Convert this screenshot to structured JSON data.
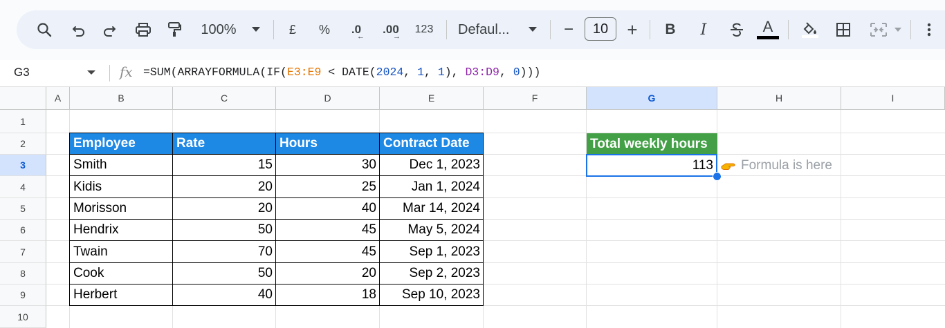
{
  "toolbar": {
    "zoom": "100%",
    "currency": "£",
    "percent": "%",
    "decrease_decimal": ".0",
    "increase_decimal": ".00",
    "number_format": "123",
    "font": "Defaul...",
    "font_size": "10",
    "minus": "−",
    "plus": "+",
    "bold": "B",
    "italic": "I",
    "text_color_letter": "A"
  },
  "formula_bar": {
    "cell_ref": "G3",
    "fx": "fx",
    "f1": "=SUM(ARRAYFORMULA(IF(",
    "f2": "E3:E9",
    "f3": " < DATE(",
    "f4": "2024",
    "f5": ", ",
    "f6": "1",
    "f7": ", ",
    "f8": "1",
    "f9": "), ",
    "f10": "D3:D9",
    "f11": ", ",
    "f12": "0",
    "f13": ")))"
  },
  "colors": {
    "header_blue": "#1e88e5",
    "header_green": "#43a047",
    "range_orange": "#e37400",
    "range_purple": "#8e24aa",
    "number_blue": "#1a56c4"
  },
  "columns": [
    "A",
    "B",
    "C",
    "D",
    "E",
    "F",
    "G",
    "H",
    "I"
  ],
  "rows": [
    "1",
    "2",
    "3",
    "4",
    "5",
    "6",
    "7",
    "8",
    "9",
    "10"
  ],
  "table": {
    "headers": [
      "Employee",
      "Rate",
      "Hours",
      "Contract Date"
    ],
    "rows": [
      [
        "Smith",
        "15",
        "30",
        "Dec 1, 2023"
      ],
      [
        "Kidis",
        "20",
        "25",
        "Jan 1, 2024"
      ],
      [
        "Morisson",
        "20",
        "40",
        "Mar 14, 2024"
      ],
      [
        "Hendrix",
        "50",
        "45",
        "May 5, 2024"
      ],
      [
        "Twain",
        "70",
        "45",
        "Sep 1, 2023"
      ],
      [
        "Cook",
        "50",
        "20",
        "Sep 2, 2023"
      ],
      [
        "Herbert",
        "40",
        "18",
        "Sep 10, 2023"
      ]
    ]
  },
  "summary": {
    "header": "Total weekly hours",
    "value": "113",
    "note": "Formula is here"
  }
}
